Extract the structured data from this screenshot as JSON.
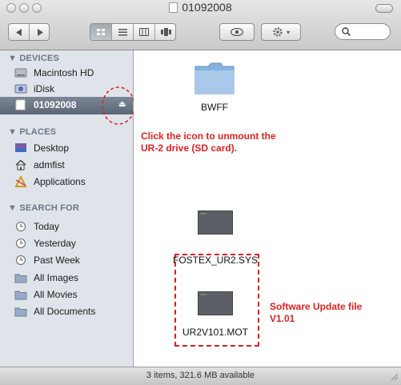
{
  "window": {
    "title": "01092008"
  },
  "toolbar": {
    "back_icon": "chevron-left-icon",
    "forward_icon": "chevron-right-icon",
    "view_icons": [
      "icon-view-icon",
      "list-view-icon",
      "column-view-icon",
      "cover-flow-icon"
    ],
    "quicklook_icon": "eye-icon",
    "action_icon": "gear-icon",
    "search_placeholder": ""
  },
  "sidebar": {
    "devices_header": "▼ DEVICES",
    "devices": [
      {
        "label": "Macintosh HD",
        "icon": "hard-drive-icon"
      },
      {
        "label": "iDisk",
        "icon": "idisk-icon"
      },
      {
        "label": "01092008",
        "icon": "sd-card-icon",
        "selected": true,
        "eject_icon": "eject-icon"
      }
    ],
    "places_header": "▼ PLACES",
    "places": [
      {
        "label": "Desktop",
        "icon": "desktop-icon"
      },
      {
        "label": "admfist",
        "icon": "home-icon"
      },
      {
        "label": "Applications",
        "icon": "applications-icon"
      }
    ],
    "search_header": "▼ SEARCH FOR",
    "searches": [
      {
        "label": "Today",
        "icon": "clock-icon"
      },
      {
        "label": "Yesterday",
        "icon": "clock-icon"
      },
      {
        "label": "Past Week",
        "icon": "clock-icon"
      },
      {
        "label": "All Images",
        "icon": "smart-folder-icon"
      },
      {
        "label": "All Movies",
        "icon": "smart-folder-icon"
      },
      {
        "label": "All Documents",
        "icon": "smart-folder-icon"
      }
    ]
  },
  "files": [
    {
      "name": "BWFF",
      "icon": "folder-icon"
    },
    {
      "name": "FOSTEX_UR2.SYS",
      "icon": "file-icon"
    },
    {
      "name": "UR2V101.MOT",
      "icon": "file-icon"
    }
  ],
  "annotations": {
    "unmount": "Click the icon to unmount the UR-2 drive (SD card).",
    "update_line1": "Software Update file",
    "update_line2": "V1.01",
    "color": "#e02020"
  },
  "statusbar": {
    "text": "3 items, 321.6 MB available"
  }
}
